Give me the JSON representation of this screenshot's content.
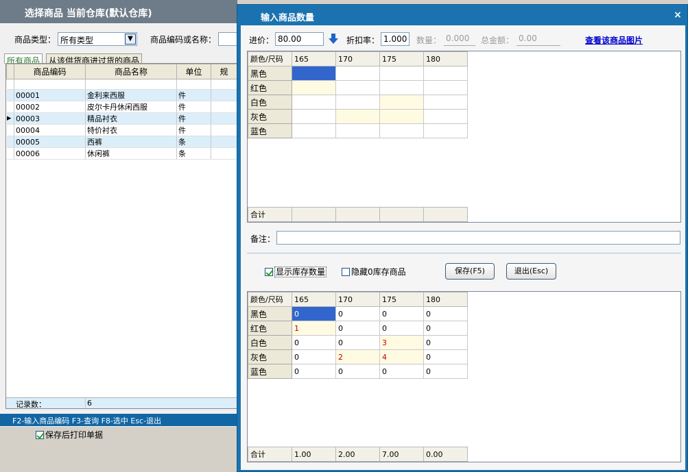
{
  "bg_window": {
    "title": "选择商品 当前仓库(默认仓库)",
    "category_label": "商品类型：",
    "category_value": "所有类型",
    "code_label": "商品编码或名称：",
    "tabs": [
      "所有商品",
      "从该供货商进过货的商品"
    ],
    "columns": [
      "商品编码",
      "商品名称",
      "单位",
      "规"
    ],
    "rows": [
      {
        "code": "00001",
        "name": "金利来西服",
        "unit": "件"
      },
      {
        "code": "00002",
        "name": "皮尔卡丹休闲西服",
        "unit": "件"
      },
      {
        "code": "00003",
        "name": "精品衬衣",
        "unit": "件"
      },
      {
        "code": "00004",
        "name": "特价衬衣",
        "unit": "件"
      },
      {
        "code": "00005",
        "name": "西裤",
        "unit": "条"
      },
      {
        "code": "00006",
        "name": "休闲裤",
        "unit": "条"
      }
    ],
    "record_label": "记录数：",
    "record_count": "6",
    "status_hint": "F2-输入商品编码 F3-查询 F8-选中 Esc-退出",
    "print_after_save": "保存后打印单据"
  },
  "dialog": {
    "title": "输入商品数量",
    "close_glyph": "×",
    "price_label": "进价：",
    "price_value": "80.00",
    "discount_label": "折扣率：",
    "discount_value": "1.000",
    "qty_label": "数量：",
    "qty_value": "0.000",
    "amount_label": "总金额：",
    "amount_value": "0.00",
    "view_image_link": "查看该商品图片",
    "grid_header": "颜色/尺码",
    "sizes": [
      "165",
      "170",
      "175",
      "180"
    ],
    "colors": [
      "黑色",
      "红色",
      "白色",
      "灰色",
      "蓝色"
    ],
    "total_label": "合计",
    "note_label": "备注：",
    "show_stock_label": "显示库存数量",
    "hide_zero_label": "隐藏0库存商品",
    "save_button": "保存(F5)",
    "exit_button": "退出(Esc)",
    "stock_values": [
      [
        "0",
        "0",
        "0",
        "0"
      ],
      [
        "1",
        "0",
        "0",
        "0"
      ],
      [
        "0",
        "0",
        "3",
        "0"
      ],
      [
        "0",
        "2",
        "4",
        "0"
      ],
      [
        "0",
        "0",
        "0",
        "0"
      ]
    ],
    "stock_totals": [
      "1.00",
      "2.00",
      "7.00",
      "0.00"
    ],
    "accent_color": "#1a73b0",
    "selected_cell_color": "#3266cc"
  }
}
